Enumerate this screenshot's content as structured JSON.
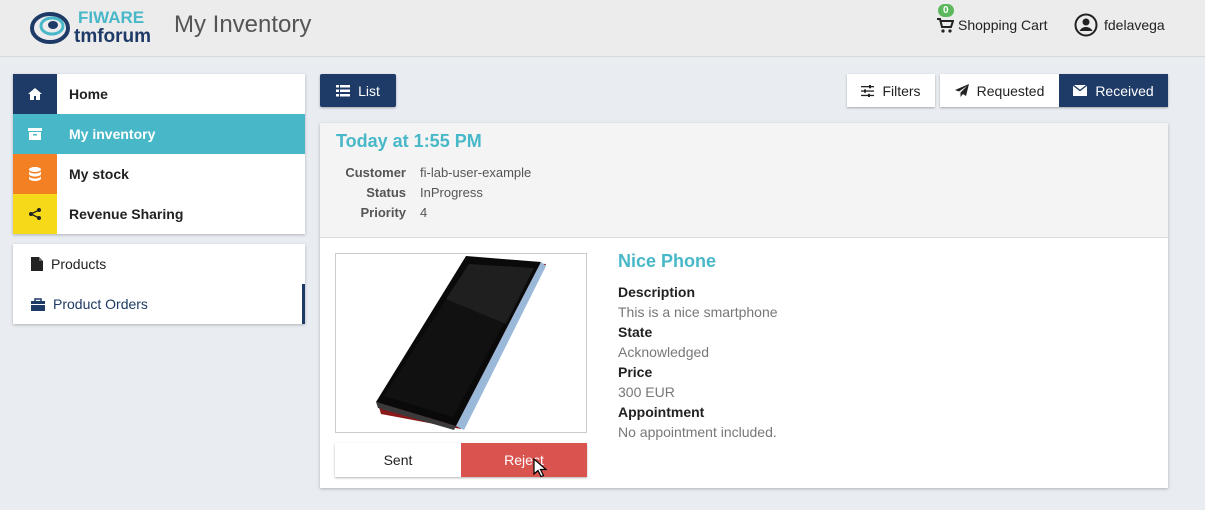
{
  "header": {
    "logo_top": "FIWARE",
    "logo_bottom": "tmforum",
    "title": "My Inventory",
    "cart_label": "Shopping Cart",
    "cart_count": "0",
    "username": "fdelavega"
  },
  "sidebar": {
    "items": [
      {
        "label": "Home",
        "icon": "home-icon"
      },
      {
        "label": "My inventory",
        "icon": "archive-icon"
      },
      {
        "label": "My stock",
        "icon": "database-icon"
      },
      {
        "label": "Revenue Sharing",
        "icon": "share-icon"
      }
    ],
    "subitems": [
      {
        "label": "Products",
        "icon": "file-icon"
      },
      {
        "label": "Product Orders",
        "icon": "briefcase-icon"
      }
    ]
  },
  "toolbar": {
    "list_label": "List",
    "filters_label": "Filters",
    "requested_label": "Requested",
    "received_label": "Received"
  },
  "order": {
    "date": "Today at 1:55 PM",
    "meta": [
      {
        "key": "Customer",
        "value": "fi-lab-user-example"
      },
      {
        "key": "Status",
        "value": "InProgress"
      },
      {
        "key": "Priority",
        "value": "4"
      }
    ],
    "product": {
      "name": "Nice Phone",
      "fields": [
        {
          "key": "Description",
          "value": "This is a nice smartphone"
        },
        {
          "key": "State",
          "value": "Acknowledged"
        },
        {
          "key": "Price",
          "value": "300 EUR"
        },
        {
          "key": "Appointment",
          "value": "No appointment included."
        }
      ]
    },
    "actions": {
      "sent_label": "Sent",
      "reject_label": "Reject"
    }
  },
  "colors": {
    "primary": "#1e3a67",
    "accent": "#48b8c9",
    "orange": "#f48024",
    "yellow": "#f6d918",
    "danger": "#d9534f"
  }
}
